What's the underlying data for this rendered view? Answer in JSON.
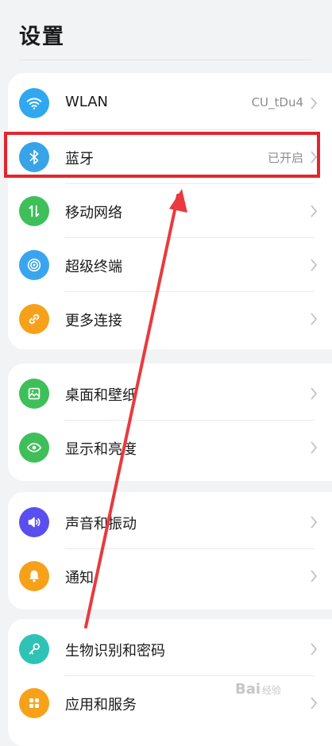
{
  "page": {
    "title": "设置"
  },
  "groups": [
    {
      "items": [
        {
          "label": "WLAN",
          "value": "CU_tDu4",
          "icon": "wifi-icon",
          "color": "#2fa8ef"
        },
        {
          "label": "蓝牙",
          "value": "已开启",
          "icon": "bluetooth-icon",
          "color": "#37a4e8"
        },
        {
          "label": "移动网络",
          "value": "",
          "icon": "mobile-data-icon",
          "color": "#3fbf5a"
        },
        {
          "label": "超级终端",
          "value": "",
          "icon": "super-device-icon",
          "color": "#3aa5ef"
        },
        {
          "label": "更多连接",
          "value": "",
          "icon": "link-icon",
          "color": "#f7a11a"
        }
      ]
    },
    {
      "items": [
        {
          "label": "桌面和壁纸",
          "value": "",
          "icon": "wallpaper-icon",
          "color": "#3fbf5a"
        },
        {
          "label": "显示和亮度",
          "value": "",
          "icon": "eye-icon",
          "color": "#3fbf5a"
        }
      ]
    },
    {
      "items": [
        {
          "label": "声音和振动",
          "value": "",
          "icon": "speaker-icon",
          "color": "#5a4ef0"
        },
        {
          "label": "通知",
          "value": "",
          "icon": "bell-icon",
          "color": "#f7a11a"
        }
      ]
    },
    {
      "items": [
        {
          "label": "生物识别和密码",
          "value": "",
          "icon": "key-icon",
          "color": "#2ec3b6"
        },
        {
          "label": "应用和服务",
          "value": "",
          "icon": "apps-icon",
          "color": "#f7a11a"
        }
      ]
    }
  ],
  "annotation": {
    "highlight_color": "#e4252e"
  },
  "watermark": {
    "brand": "Bai",
    "sub": "经验"
  }
}
